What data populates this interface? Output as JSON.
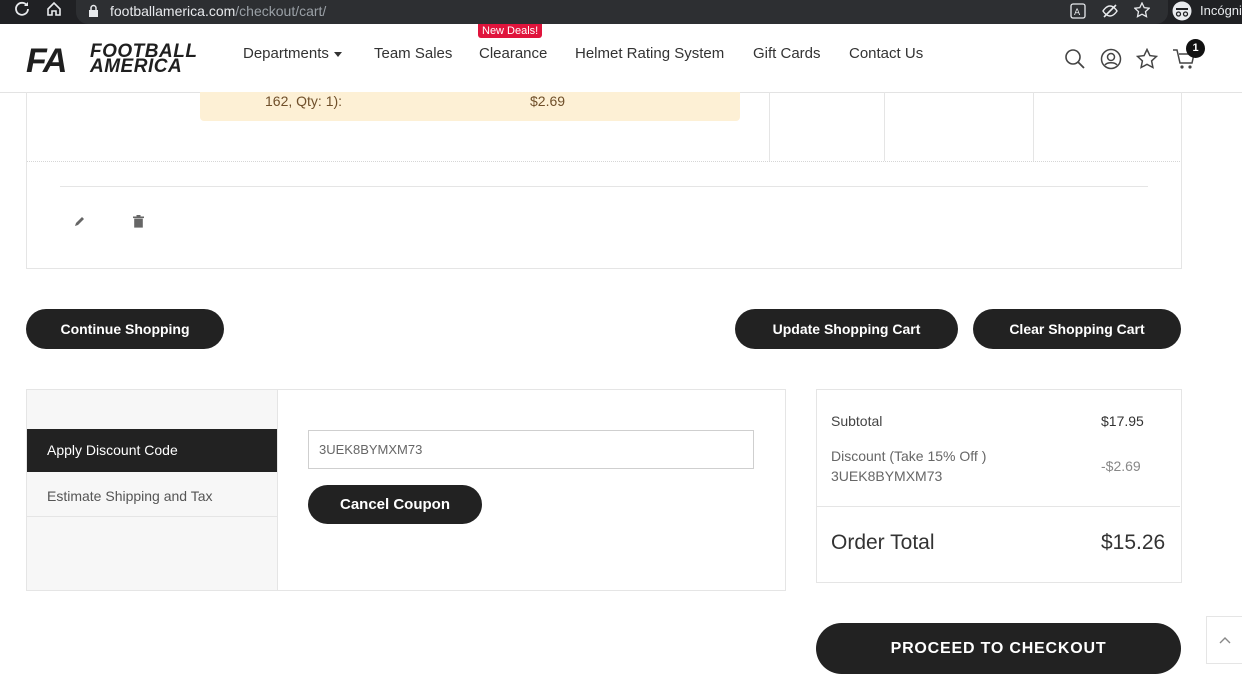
{
  "browser": {
    "url_host": "footballamerica.com",
    "url_path": "/checkout/cart/",
    "incognito_label": "Incógnit"
  },
  "header": {
    "logo_mark": "FA",
    "logo_line1": "FOOTBALL",
    "logo_line2": "AMERICA",
    "nav": {
      "departments": "Departments",
      "team_sales": "Team Sales",
      "clearance": "Clearance",
      "clearance_badge": "New Deals!",
      "helmet_rating": "Helmet Rating System",
      "gift_cards": "Gift Cards",
      "contact_us": "Contact Us"
    },
    "cart_count": "1"
  },
  "cart_item": {
    "promo_text": "162, Qty: 1):",
    "promo_amount": "$2.69"
  },
  "actions": {
    "continue_shopping": "Continue Shopping",
    "update_cart": "Update Shopping Cart",
    "clear_cart": "Clear Shopping Cart"
  },
  "discount": {
    "tab_apply": "Apply Discount Code",
    "tab_estimate": "Estimate Shipping and Tax",
    "code_value": "3UEK8BYMXM73",
    "cancel_coupon": "Cancel Coupon"
  },
  "summary": {
    "subtotal_label": "Subtotal",
    "subtotal_value": "$17.95",
    "discount_label": "Discount (Take 15% Off )",
    "discount_code": "3UEK8BYMXM73",
    "discount_value": "-$2.69",
    "order_total_label": "Order Total",
    "order_total_value": "$15.26"
  },
  "checkout": {
    "proceed": "PROCEED TO CHECKOUT"
  },
  "colors": {
    "dark": "#222222",
    "badge_red": "#e0143c",
    "promo_bg": "#fdf0d5"
  },
  "icons": [
    "reload-icon",
    "home-icon",
    "lock-icon",
    "translate-icon",
    "eye-off-icon",
    "star-icon",
    "incognito-icon",
    "search-icon",
    "account-icon",
    "wishlist-icon",
    "cart-icon",
    "edit-icon",
    "trash-icon",
    "chevron-up-icon"
  ]
}
